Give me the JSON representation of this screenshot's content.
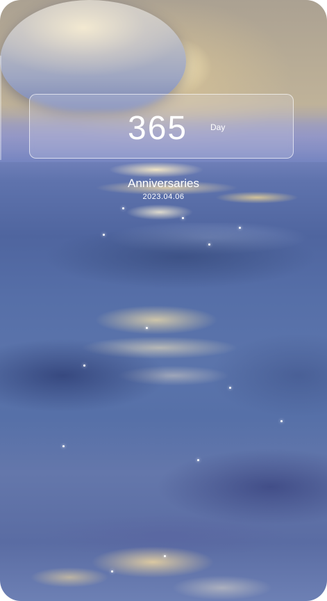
{
  "anniversary": {
    "count": "365",
    "unit": "Day",
    "title": "Anniversaries",
    "date": "2023.04.06"
  }
}
